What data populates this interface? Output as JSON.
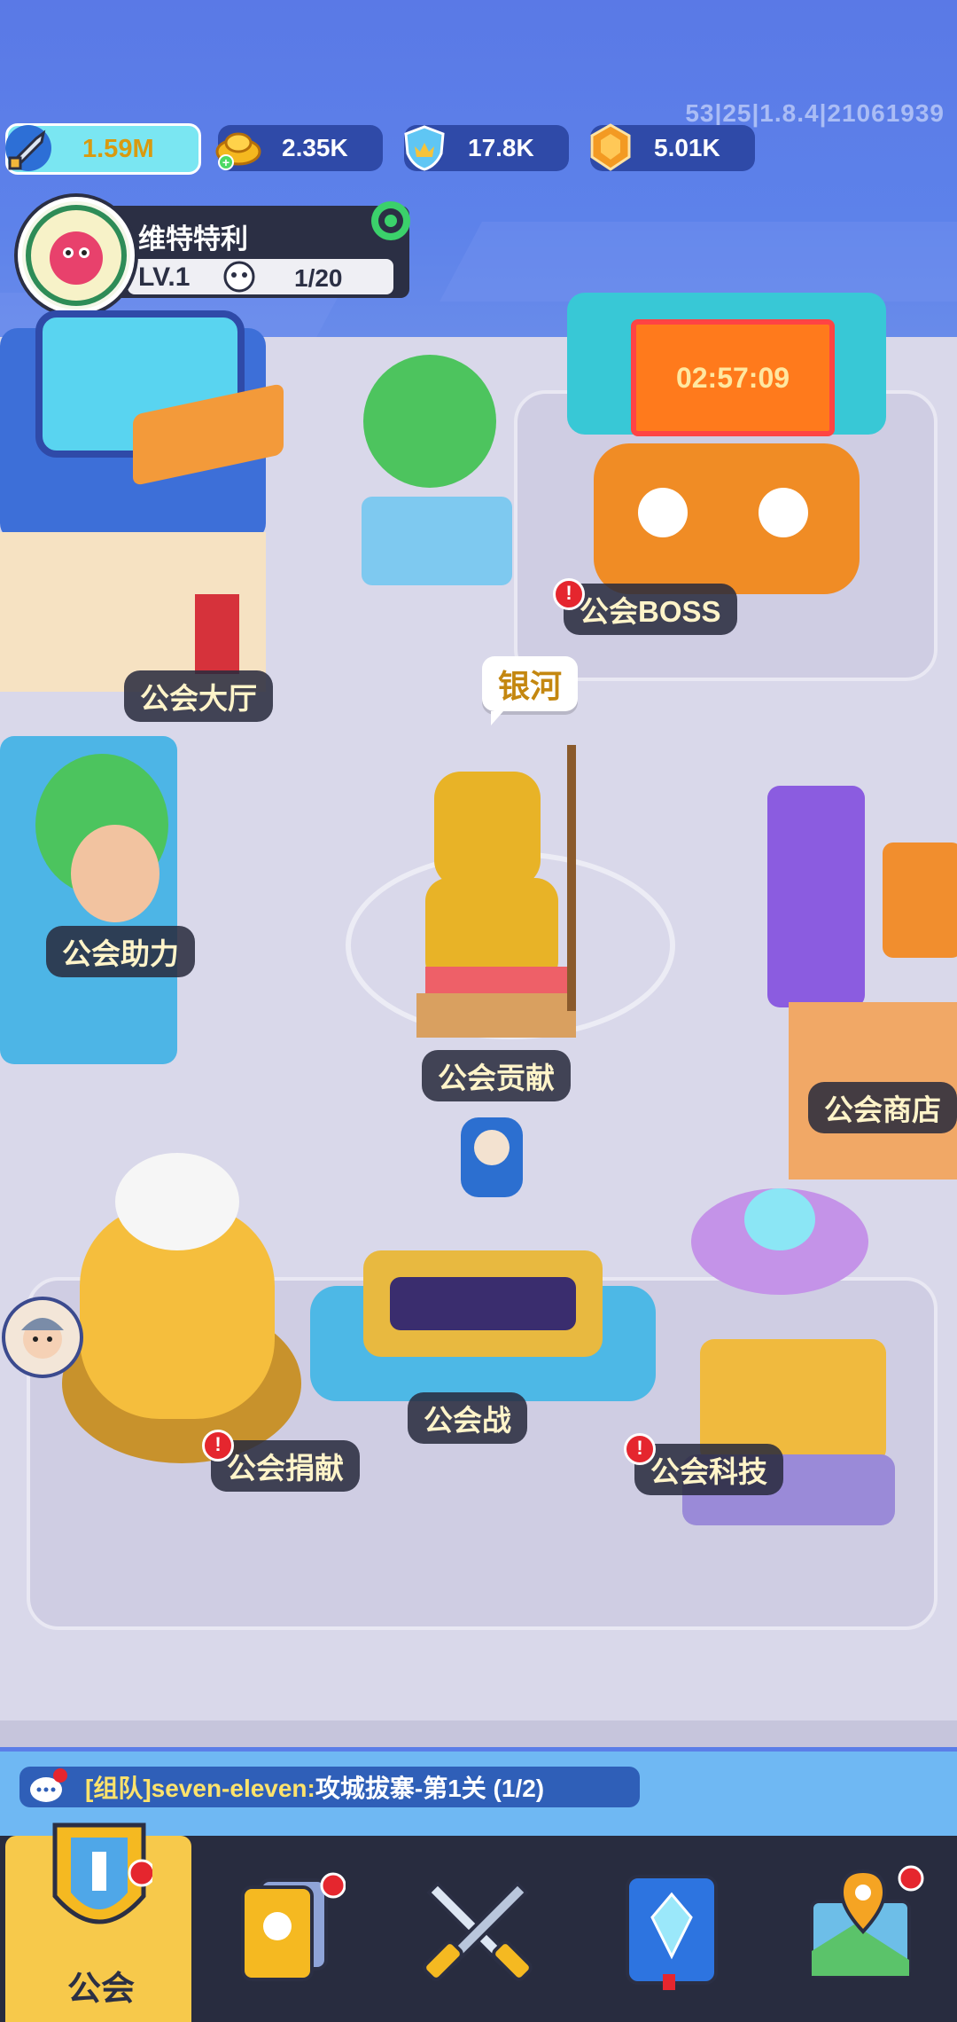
{
  "version": "53|25|1.8.4|21061939",
  "resources": {
    "power": "1.59M",
    "gold": "2.35K",
    "badge": "17.8K",
    "gem": "5.01K"
  },
  "profile": {
    "name": "维特特利",
    "level": "LV.1",
    "members": "1/20"
  },
  "buildings": {
    "hall": "公会大厅",
    "boss": "公会BOSS",
    "boss_timer": "02:57:09",
    "assist": "公会助力",
    "statue_name": "银河",
    "contribution": "公会贡献",
    "shop": "公会商店",
    "donate": "公会捐献",
    "war": "公会战",
    "tech": "公会科技"
  },
  "chat": {
    "tag": "[组队]seven-eleven:",
    "message": "攻城拔寨-第1关 (1/2)"
  },
  "nav": {
    "guild_label": "公会"
  },
  "colors": {
    "label_text": "#FFF4C9",
    "alert": "#E5262E",
    "nav_active": "#F7C94B"
  }
}
